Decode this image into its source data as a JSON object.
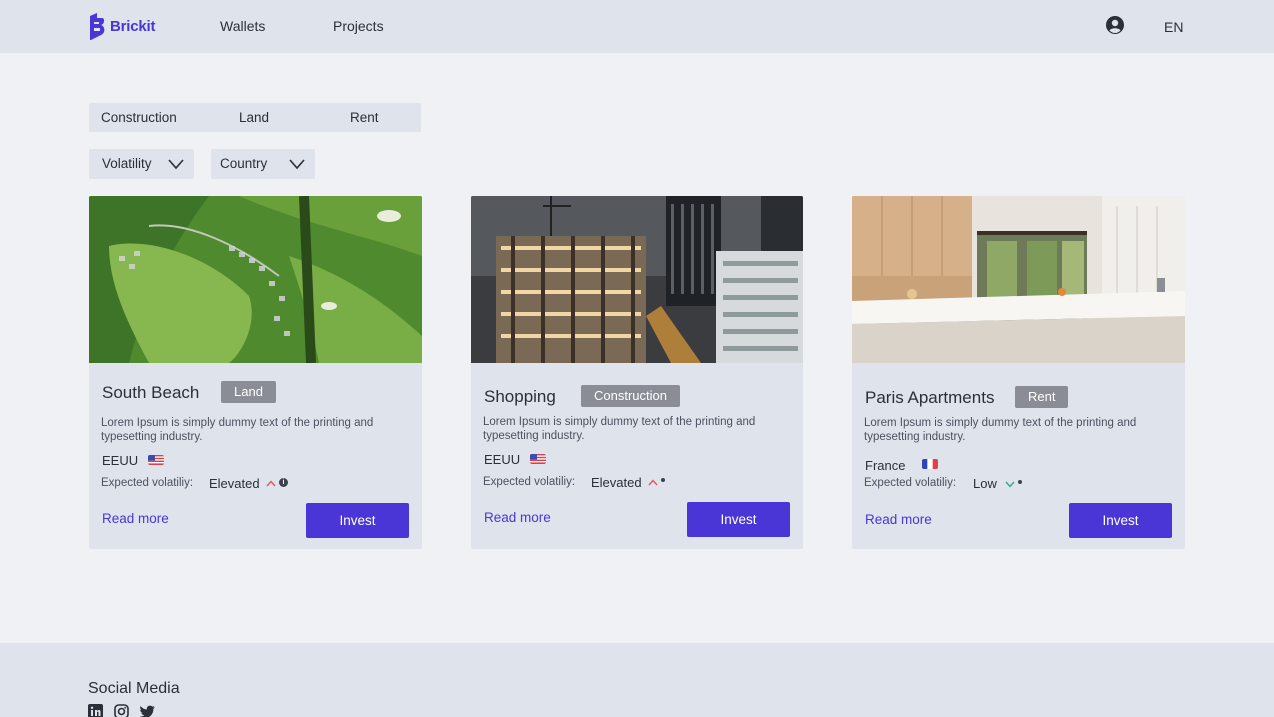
{
  "header": {
    "logo_text": "Brickit",
    "nav": [
      "Wallets",
      "Projects"
    ],
    "language": "EN"
  },
  "filters": {
    "tabs": [
      "Construction",
      "Land",
      "Rent"
    ],
    "dropdowns": [
      "Volatility",
      "Country"
    ]
  },
  "cards": [
    {
      "title": "South Beach",
      "tag": "Land",
      "description": "Lorem Ipsum is simply dummy text of the printing and typesetting industry.",
      "country": "EEUU",
      "volatility_label": "Expected volatiliy:",
      "volatility": "Elevated",
      "read_more": "Read more",
      "invest": "Invest"
    },
    {
      "title": "Shopping",
      "tag": "Construction",
      "description": "Lorem Ipsum is simply dummy text of the printing and typesetting industry.",
      "country": "EEUU",
      "volatility_label": "Expected volatiliy:",
      "volatility": "Elevated",
      "read_more": "Read more",
      "invest": "Invest"
    },
    {
      "title": "Paris Apartments",
      "tag": "Rent",
      "description": "Lorem Ipsum is simply dummy text of the printing and typesetting industry.",
      "country": "France",
      "volatility_label": "Expected volatiliy:",
      "volatility": "Low",
      "read_more": "Read more",
      "invest": "Invest"
    }
  ],
  "footer": {
    "title": "Social Media",
    "icons": [
      "linkedin-icon",
      "instagram-icon",
      "twitter-icon"
    ]
  },
  "colors": {
    "accent": "#4a35d6",
    "tag_bg": "#8a8d96",
    "elevated": "#e2555a",
    "low": "#2fa88a"
  }
}
